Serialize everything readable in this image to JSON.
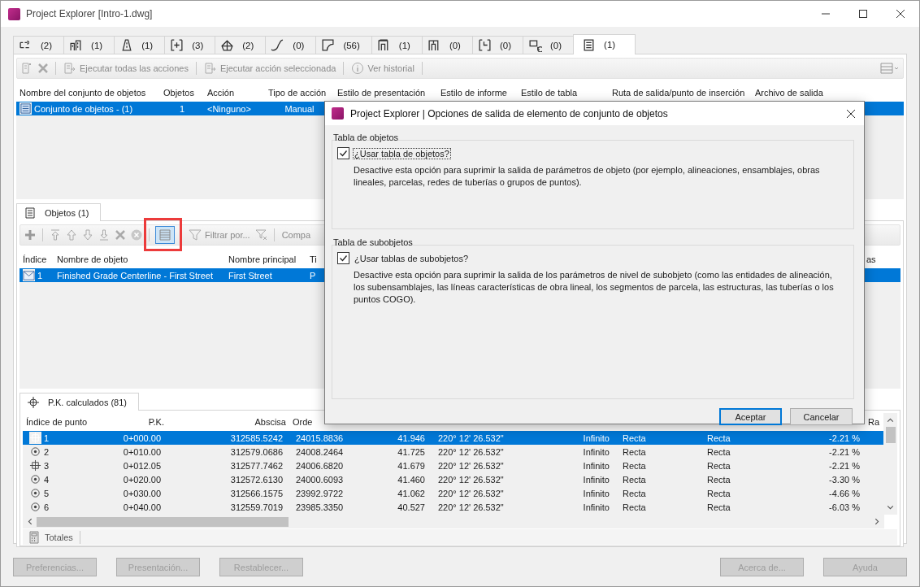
{
  "window": {
    "title": "Project Explorer [Intro-1.dwg]"
  },
  "object_tabs": [
    {
      "count": "(2)",
      "selected": false
    },
    {
      "count": "(1)",
      "selected": false
    },
    {
      "count": "(1)",
      "selected": false
    },
    {
      "count": "(3)",
      "selected": false
    },
    {
      "count": "(2)",
      "selected": false
    },
    {
      "count": "(0)",
      "selected": false
    },
    {
      "count": "(56)",
      "selected": false
    },
    {
      "count": "(1)",
      "selected": false
    },
    {
      "count": "(0)",
      "selected": false
    },
    {
      "count": "(0)",
      "selected": false
    },
    {
      "count": "(0)",
      "selected": false
    },
    {
      "count": "(1)",
      "selected": true
    }
  ],
  "toolbar": [
    {
      "label": "Ejecutar todas las acciones",
      "disabled": true
    },
    {
      "label": "Ejecutar acción seleccionada",
      "disabled": true
    },
    {
      "label": "Ver historial",
      "disabled": true
    }
  ],
  "object_sets_table": {
    "columns": [
      "Nombre del conjunto de objetos",
      "Objetos",
      "Acción",
      "Tipo de acción",
      "Estilo de presentación",
      "Estilo de informe",
      "Estilo de tabla",
      "Ruta de salida/punto de inserción",
      "Archivo de salida"
    ],
    "rows": [
      {
        "selected": true,
        "cells": [
          "Conjunto de objetos - (1)",
          "1",
          "<Ninguno>",
          "Manual"
        ]
      }
    ]
  },
  "objects_panel": {
    "tab": "Objetos (1)",
    "filter_label": "Filtrar por...",
    "toolbar_item_cut": "Compa",
    "columns": [
      "Índice",
      "Nombre de objeto",
      "Nombre principal",
      "Ti"
    ],
    "column_5": "as",
    "rows": [
      {
        "selected": true,
        "cells": [
          "1",
          "Finished Grade Centerline - First Street",
          "First Street",
          "P"
        ]
      }
    ]
  },
  "stations_panel": {
    "tab": "P.K. calculados (81)",
    "columns": [
      "Índice de punto",
      "P.K.",
      "Abscisa",
      "Orde"
    ],
    "column_11": "Ra",
    "rows": [
      {
        "kind": "geometry",
        "selected": true,
        "cells": [
          "1",
          "0+000.00",
          "312585.5242",
          "24015.8836",
          "41.946",
          "220° 12' 26.532\"",
          "Infinito",
          "Recta",
          "Recta",
          "-2.21 %"
        ]
      },
      {
        "kind": "station",
        "selected": false,
        "cells": [
          "2",
          "0+010.00",
          "312579.0686",
          "24008.2464",
          "41.725",
          "220° 12' 26.532\"",
          "Infinito",
          "Recta",
          "Recta",
          "-2.21 %"
        ]
      },
      {
        "kind": "geometry",
        "selected": false,
        "cells": [
          "3",
          "0+012.05",
          "312577.7462",
          "24006.6820",
          "41.679",
          "220° 12' 26.532\"",
          "Infinito",
          "Recta",
          "Recta",
          "-2.21 %"
        ]
      },
      {
        "kind": "station",
        "selected": false,
        "cells": [
          "4",
          "0+020.00",
          "312572.6130",
          "24000.6093",
          "41.460",
          "220° 12' 26.532\"",
          "Infinito",
          "Recta",
          "Recta",
          "-3.30 %"
        ]
      },
      {
        "kind": "station",
        "selected": false,
        "cells": [
          "5",
          "0+030.00",
          "312566.1575",
          "23992.9722",
          "41.062",
          "220° 12' 26.532\"",
          "Infinito",
          "Recta",
          "Recta",
          "-4.66 %"
        ]
      },
      {
        "kind": "station",
        "selected": false,
        "cells": [
          "6",
          "0+040.00",
          "312559.7019",
          "23985.3350",
          "40.527",
          "220° 12' 26.532\"",
          "Infinito",
          "Recta",
          "Recta",
          "-6.03 %"
        ]
      }
    ],
    "totals": "Totales"
  },
  "footer_buttons_left": [
    {
      "label": "Preferencias...",
      "disabled": true
    },
    {
      "label": "Presentación...",
      "disabled": true
    },
    {
      "label": "Restablecer...",
      "disabled": true
    }
  ],
  "footer_buttons_right": [
    {
      "label": "Acerca de...",
      "disabled": true
    },
    {
      "label": "Ayuda",
      "disabled": true
    }
  ],
  "dialog": {
    "title": "Project Explorer | Opciones de salida de elemento de conjunto de objetos",
    "groups": [
      {
        "title": "Tabla de objetos",
        "checkbox": {
          "label": "¿Usar tabla de objetos?",
          "checked": true,
          "focused": true
        },
        "description": "Desactive esta opción para suprimir la salida de parámetros de objeto (por ejemplo, alineaciones, ensamblajes, obras lineales, parcelas, redes de tuberías o grupos de puntos)."
      },
      {
        "title": "Tabla de subobjetos",
        "checkbox": {
          "label": "¿Usar tablas de subobjetos?",
          "checked": true,
          "focused": false
        },
        "description": "Desactive esta opción para suprimir la salida de los parámetros de nivel de subobjeto (como las entidades de alineación, los subensamblajes, las líneas características de obra lineal, los segmentos de parcela, las estructuras, las tuberías o los puntos COGO)."
      }
    ],
    "buttons": [
      {
        "label": "Aceptar",
        "default": true
      },
      {
        "label": "Cancelar",
        "default": false
      }
    ]
  }
}
